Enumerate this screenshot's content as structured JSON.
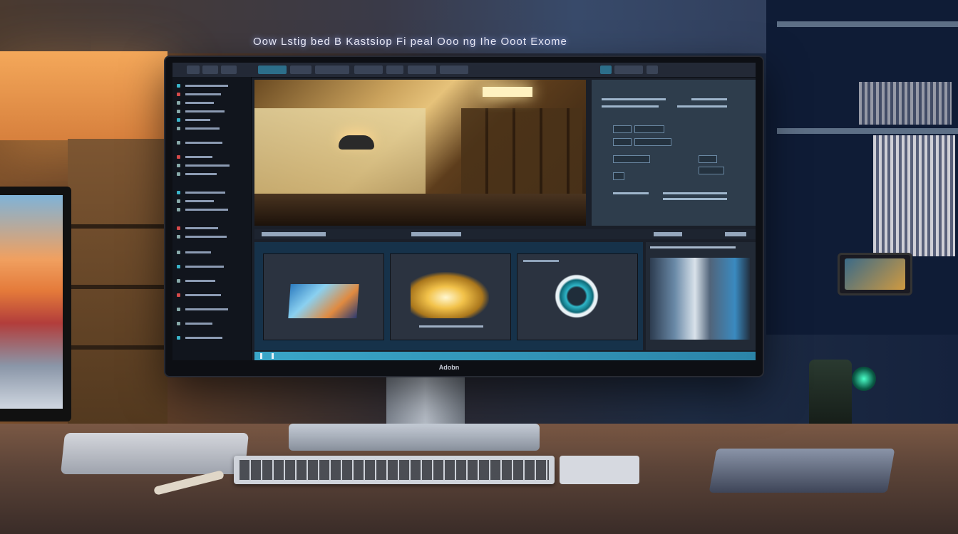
{
  "overhead_title": "Oow Lstig bed B Kastsiop Fi peal Ooo  ng Ihe Ooot Exome",
  "monitor_brand": "Adobn",
  "colors": {
    "toolbar_bg": "#232936",
    "panel_bg": "#11151d",
    "inspector_bg": "#2e3d4c",
    "bin_bg": "#16324a",
    "timeline_accent": "#3aa6c8",
    "room_warm": "#f4a85a",
    "room_cool": "#15223d"
  },
  "icons": [
    "monitor-icon",
    "keyboard-icon",
    "lamp-icon",
    "speaker-icon"
  ]
}
